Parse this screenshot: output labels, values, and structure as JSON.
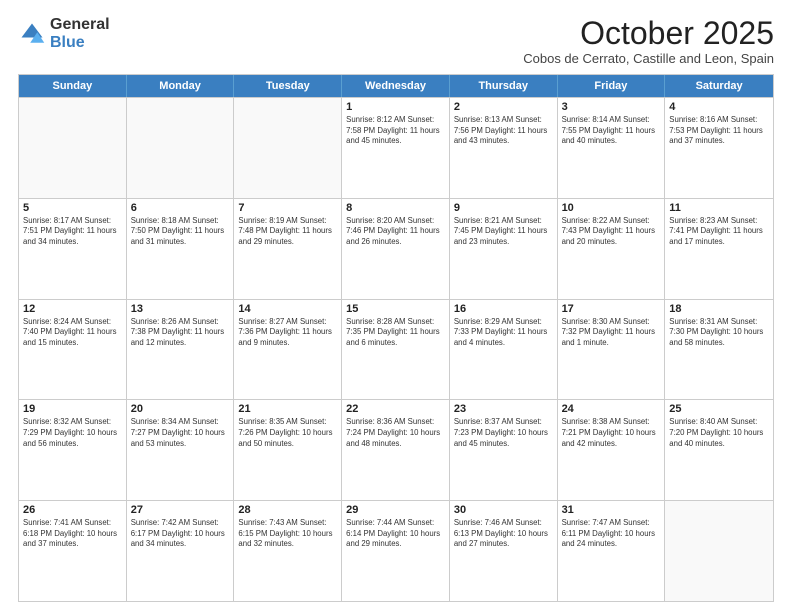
{
  "logo": {
    "general": "General",
    "blue": "Blue"
  },
  "header": {
    "month": "October 2025",
    "subtitle": "Cobos de Cerrato, Castille and Leon, Spain"
  },
  "days": [
    "Sunday",
    "Monday",
    "Tuesday",
    "Wednesday",
    "Thursday",
    "Friday",
    "Saturday"
  ],
  "weeks": [
    [
      {
        "day": "",
        "info": ""
      },
      {
        "day": "",
        "info": ""
      },
      {
        "day": "",
        "info": ""
      },
      {
        "day": "1",
        "info": "Sunrise: 8:12 AM\nSunset: 7:58 PM\nDaylight: 11 hours\nand 45 minutes."
      },
      {
        "day": "2",
        "info": "Sunrise: 8:13 AM\nSunset: 7:56 PM\nDaylight: 11 hours\nand 43 minutes."
      },
      {
        "day": "3",
        "info": "Sunrise: 8:14 AM\nSunset: 7:55 PM\nDaylight: 11 hours\nand 40 minutes."
      },
      {
        "day": "4",
        "info": "Sunrise: 8:16 AM\nSunset: 7:53 PM\nDaylight: 11 hours\nand 37 minutes."
      }
    ],
    [
      {
        "day": "5",
        "info": "Sunrise: 8:17 AM\nSunset: 7:51 PM\nDaylight: 11 hours\nand 34 minutes."
      },
      {
        "day": "6",
        "info": "Sunrise: 8:18 AM\nSunset: 7:50 PM\nDaylight: 11 hours\nand 31 minutes."
      },
      {
        "day": "7",
        "info": "Sunrise: 8:19 AM\nSunset: 7:48 PM\nDaylight: 11 hours\nand 29 minutes."
      },
      {
        "day": "8",
        "info": "Sunrise: 8:20 AM\nSunset: 7:46 PM\nDaylight: 11 hours\nand 26 minutes."
      },
      {
        "day": "9",
        "info": "Sunrise: 8:21 AM\nSunset: 7:45 PM\nDaylight: 11 hours\nand 23 minutes."
      },
      {
        "day": "10",
        "info": "Sunrise: 8:22 AM\nSunset: 7:43 PM\nDaylight: 11 hours\nand 20 minutes."
      },
      {
        "day": "11",
        "info": "Sunrise: 8:23 AM\nSunset: 7:41 PM\nDaylight: 11 hours\nand 17 minutes."
      }
    ],
    [
      {
        "day": "12",
        "info": "Sunrise: 8:24 AM\nSunset: 7:40 PM\nDaylight: 11 hours\nand 15 minutes."
      },
      {
        "day": "13",
        "info": "Sunrise: 8:26 AM\nSunset: 7:38 PM\nDaylight: 11 hours\nand 12 minutes."
      },
      {
        "day": "14",
        "info": "Sunrise: 8:27 AM\nSunset: 7:36 PM\nDaylight: 11 hours\nand 9 minutes."
      },
      {
        "day": "15",
        "info": "Sunrise: 8:28 AM\nSunset: 7:35 PM\nDaylight: 11 hours\nand 6 minutes."
      },
      {
        "day": "16",
        "info": "Sunrise: 8:29 AM\nSunset: 7:33 PM\nDaylight: 11 hours\nand 4 minutes."
      },
      {
        "day": "17",
        "info": "Sunrise: 8:30 AM\nSunset: 7:32 PM\nDaylight: 11 hours\nand 1 minute."
      },
      {
        "day": "18",
        "info": "Sunrise: 8:31 AM\nSunset: 7:30 PM\nDaylight: 10 hours\nand 58 minutes."
      }
    ],
    [
      {
        "day": "19",
        "info": "Sunrise: 8:32 AM\nSunset: 7:29 PM\nDaylight: 10 hours\nand 56 minutes."
      },
      {
        "day": "20",
        "info": "Sunrise: 8:34 AM\nSunset: 7:27 PM\nDaylight: 10 hours\nand 53 minutes."
      },
      {
        "day": "21",
        "info": "Sunrise: 8:35 AM\nSunset: 7:26 PM\nDaylight: 10 hours\nand 50 minutes."
      },
      {
        "day": "22",
        "info": "Sunrise: 8:36 AM\nSunset: 7:24 PM\nDaylight: 10 hours\nand 48 minutes."
      },
      {
        "day": "23",
        "info": "Sunrise: 8:37 AM\nSunset: 7:23 PM\nDaylight: 10 hours\nand 45 minutes."
      },
      {
        "day": "24",
        "info": "Sunrise: 8:38 AM\nSunset: 7:21 PM\nDaylight: 10 hours\nand 42 minutes."
      },
      {
        "day": "25",
        "info": "Sunrise: 8:40 AM\nSunset: 7:20 PM\nDaylight: 10 hours\nand 40 minutes."
      }
    ],
    [
      {
        "day": "26",
        "info": "Sunrise: 7:41 AM\nSunset: 6:18 PM\nDaylight: 10 hours\nand 37 minutes."
      },
      {
        "day": "27",
        "info": "Sunrise: 7:42 AM\nSunset: 6:17 PM\nDaylight: 10 hours\nand 34 minutes."
      },
      {
        "day": "28",
        "info": "Sunrise: 7:43 AM\nSunset: 6:15 PM\nDaylight: 10 hours\nand 32 minutes."
      },
      {
        "day": "29",
        "info": "Sunrise: 7:44 AM\nSunset: 6:14 PM\nDaylight: 10 hours\nand 29 minutes."
      },
      {
        "day": "30",
        "info": "Sunrise: 7:46 AM\nSunset: 6:13 PM\nDaylight: 10 hours\nand 27 minutes."
      },
      {
        "day": "31",
        "info": "Sunrise: 7:47 AM\nSunset: 6:11 PM\nDaylight: 10 hours\nand 24 minutes."
      },
      {
        "day": "",
        "info": ""
      }
    ]
  ]
}
